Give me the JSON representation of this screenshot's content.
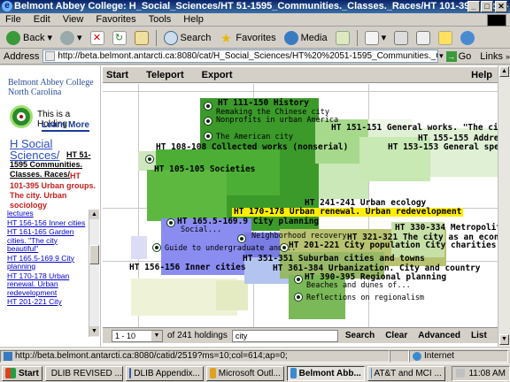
{
  "window": {
    "title": "Belmont Abbey College: H_Social_Sciences/HT 51-1595_Communities._Classes._Races/HT 101-395_Urba - Microsoft Internet E..."
  },
  "menu": [
    "File",
    "Edit",
    "View",
    "Favorites",
    "Tools",
    "Help"
  ],
  "toolbar": {
    "back": "Back",
    "search": "Search",
    "favorites": "Favorites",
    "media": "Media"
  },
  "address": {
    "label": "Address",
    "url": "http://beta.belmont.antarcti.ca:8080/cat/H_Social_Sciences/HT%20%2051-1595_Communities._Classes._Races/HT%2",
    "go": "Go",
    "links": "Links"
  },
  "left": {
    "college": [
      "Belmont Abbey College",
      "North Carolina"
    ],
    "holding_text": "This is a Holding",
    "learn_more": "Learn More",
    "crumb_main": "H Social Sciences/",
    "crumb_bold": "HT 51-1595 Communities. Classes. Races/",
    "crumb_red": "HT 101-395 Urban groups. The city. Urban sociology",
    "links": [
      "lectures",
      "HT 156-156 Inner cities",
      "HT 161-165 Garden cities. \"The city beautiful\"",
      "HT 165.5-169.9 City planning",
      "HT 170-178 Urban renewal. Urban redevelopment",
      "HT 201-221 City"
    ]
  },
  "viz": {
    "menu": {
      "start": "Start",
      "teleport": "Teleport",
      "export": "Export",
      "help": "Help"
    },
    "labels": {
      "history": "HT 111-150 History",
      "remaking": "Remaking the Chinese city",
      "nonprofits": "Nonprofits in urban America",
      "american_city": "The American city",
      "general_works": "HT 151-151 General works. \"The city prob",
      "addre": "HT 155-155 Addre",
      "general_spec": "HT 153-153 General spec",
      "collected": "HT 108-108 Collected works (nonserial)",
      "societies": "HT 105-105 Societies",
      "ecology": "HT 241-241 Urban ecology",
      "renewal": "HT 170-178 Urban renewal. Urban redevelopment",
      "planning": "HT 165.5-169.9 City planning",
      "social": "Social...",
      "neighborhood": "Neighborhood recovery",
      "guide": "Guide to undergraduate and...",
      "metropolitan": "HT 330-334 Metropolitan",
      "economic": "HT 321-321 The city as an economi",
      "charities": "HT 201-221 City population City charities Police C",
      "suburban": "HT 351-351 Suburban cities and towns",
      "inner": "HT 156-156 Inner cities",
      "urbanization": "HT 361-384 Urbanization. City and country",
      "regional": "HT 390-395 Regional planning",
      "beaches": "Beaches and dunes of...",
      "reflections": "Reflections on regionalism"
    },
    "bottom": {
      "range": "1 - 10",
      "of": "of 241 holdings",
      "query": "city",
      "search": "Search",
      "clear": "Clear",
      "advanced": "Advanced",
      "list": "List"
    }
  },
  "status": {
    "url": "http://beta.belmont.antarcti.ca:8080/catid/2519?ms=10;col=614;ap=0;",
    "zone": "Internet"
  },
  "taskbar": {
    "start": "Start",
    "items": [
      "DLIB REVISED ...",
      "DLIB Appendix...",
      "Microsoft Outl...",
      "Belmont Abb...",
      "AT&T and MCI ..."
    ],
    "clock": "11:08 AM"
  },
  "colors": {
    "green_dark": "#3b9a2a",
    "green_mid": "#5db840",
    "green_light": "#a6d98c",
    "blue": "#8a8cf0",
    "olive": "#b8c270",
    "highlight": "#ffee00"
  }
}
